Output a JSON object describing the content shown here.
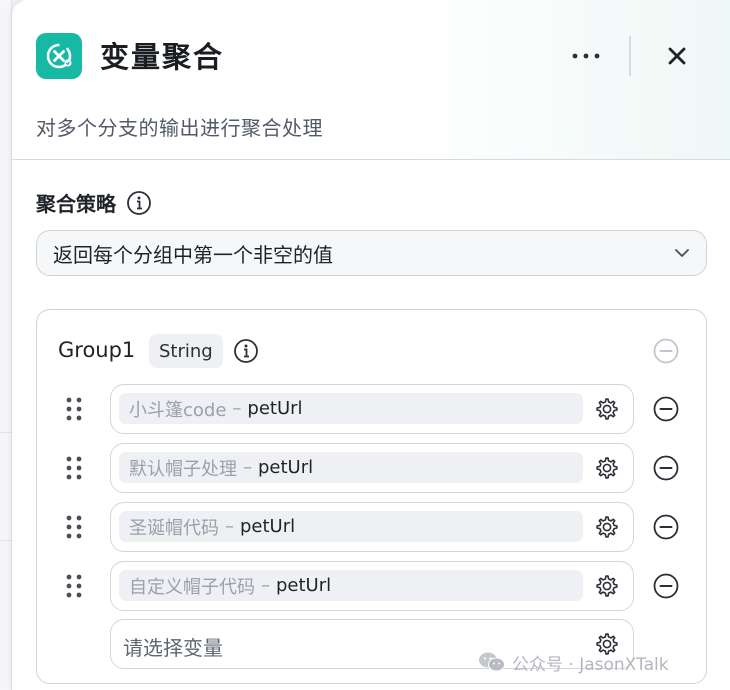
{
  "panel": {
    "title": "变量聚合",
    "subtitle": "对多个分支的输出进行聚合处理",
    "accent_color": "#16b9a4"
  },
  "strategy": {
    "label": "聚合策略",
    "selected": "返回每个分组中第一个非空的值"
  },
  "group": {
    "name": "Group1",
    "type": "String",
    "variables": [
      {
        "node": "小斗篷code",
        "separator": "–",
        "field": "petUrl"
      },
      {
        "node": "默认帽子处理",
        "separator": "–",
        "field": "petUrl"
      },
      {
        "node": "圣诞帽代码",
        "separator": "–",
        "field": "petUrl"
      },
      {
        "node": "自定义帽子代码",
        "separator": "–",
        "field": "petUrl"
      }
    ],
    "add_placeholder": "请选择变量"
  },
  "watermark": {
    "text": "公众号 · JasonXTalk"
  }
}
